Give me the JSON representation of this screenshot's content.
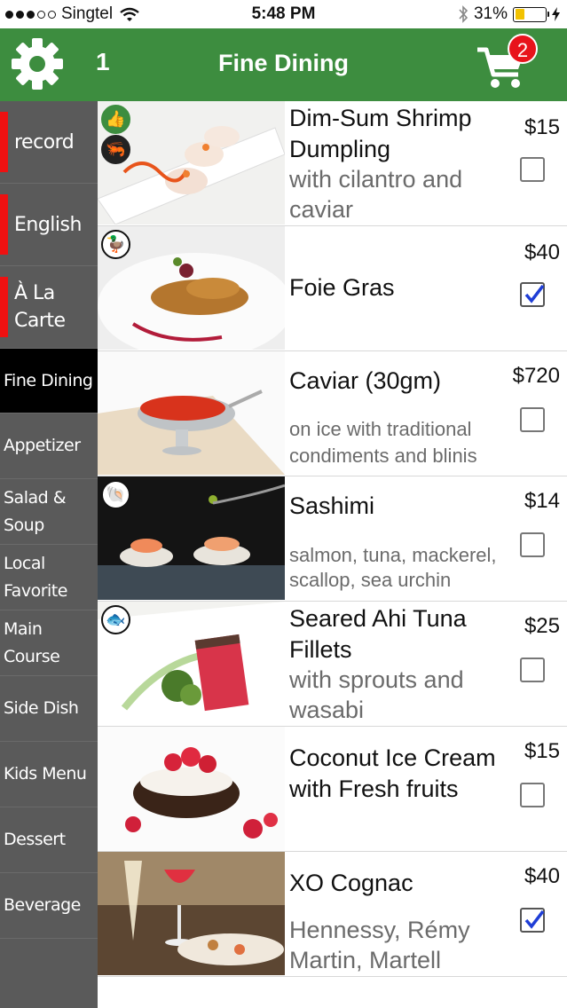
{
  "status_bar": {
    "carrier": "Singtel",
    "time": "5:48 PM",
    "battery": "31%",
    "battery_level": 0.31
  },
  "header": {
    "table_number": "1",
    "title": "Fine Dining",
    "cart_count": "2",
    "accent_color": "#3d8d3f",
    "badge_color": "#e8131b"
  },
  "sidebar": {
    "items": [
      {
        "label": "record",
        "type": "top"
      },
      {
        "label": "English",
        "type": "top"
      },
      {
        "label": "À La Carte",
        "type": "top"
      },
      {
        "label": "Fine Dining",
        "active": true
      },
      {
        "label": "Appetizer"
      },
      {
        "label": "Salad & Soup"
      },
      {
        "label": "Local Favorite"
      },
      {
        "label": "Main Course"
      },
      {
        "label": "Side Dish"
      },
      {
        "label": "Kids Menu"
      },
      {
        "label": "Dessert"
      },
      {
        "label": "Beverage"
      }
    ]
  },
  "menu": {
    "items": [
      {
        "name": "Dim-Sum Shrimp Dumpling",
        "description": "with cilantro and caviar",
        "price": "$15",
        "checked": false,
        "icons": [
          "thumbs-up-icon",
          "shrimp-icon"
        ]
      },
      {
        "name": "Foie Gras",
        "description": "",
        "price": "$40",
        "checked": true,
        "icons": [
          "duck-icon"
        ]
      },
      {
        "name": "Caviar (30gm)",
        "description": "on ice with traditional condiments and blinis",
        "price": "$720",
        "checked": false,
        "icons": []
      },
      {
        "name": "Sashimi",
        "description": "salmon, tuna, mackerel, scallop, sea urchin",
        "price": "$14",
        "checked": false,
        "icons": [
          "shellfish-icon"
        ]
      },
      {
        "name": "Seared Ahi Tuna Fillets",
        "description": "with sprouts and wasabi",
        "price": "$25",
        "checked": false,
        "icons": [
          "fish-icon"
        ]
      },
      {
        "name": "Coconut Ice Cream with Fresh fruits",
        "description": "",
        "price": "$15",
        "checked": false,
        "icons": []
      },
      {
        "name": "XO Cognac",
        "description": "Hennessy, Rémy Martin, Martell",
        "price": "$40",
        "checked": true,
        "icons": []
      }
    ]
  }
}
